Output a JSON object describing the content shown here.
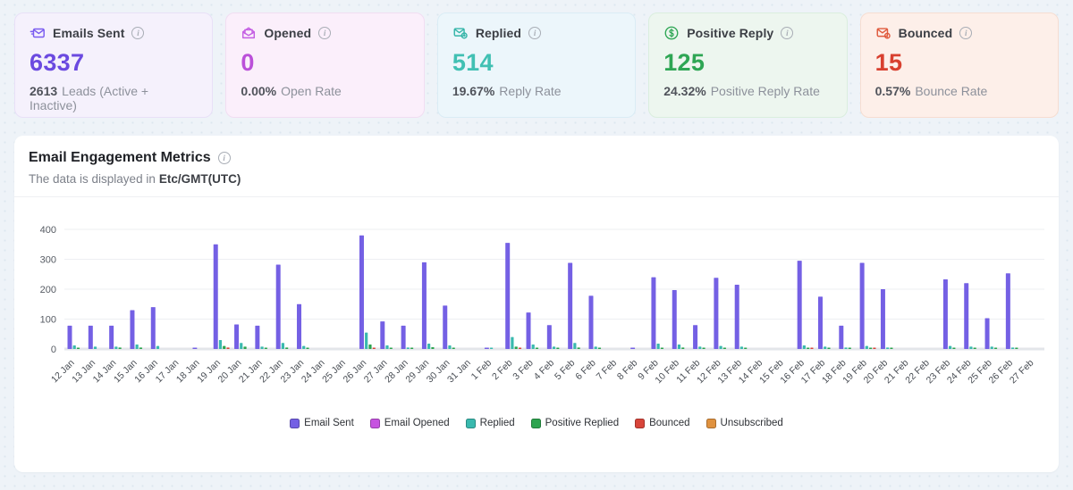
{
  "cards": [
    {
      "label": "Emails Sent",
      "value": "6337",
      "sub_value": "2613",
      "sub_label": "Leads (Active + Inactive)",
      "accent": "#6b4ae0",
      "icon_color": "#7a5cf0",
      "bg": "#f5f1fc",
      "border": "#e8e0f7",
      "icon": "send-envelope-icon"
    },
    {
      "label": "Opened",
      "value": "0",
      "sub_value": "0.00%",
      "sub_label": "Open Rate",
      "accent": "#bb50d9",
      "icon_color": "#c45fe3",
      "bg": "#fbeffb",
      "border": "#f1ddf2",
      "icon": "open-envelope-icon"
    },
    {
      "label": "Replied",
      "value": "514",
      "sub_value": "19.67%",
      "sub_label": "Reply Rate",
      "accent": "#41c0b3",
      "icon_color": "#35b5a9",
      "bg": "#ecf6fb",
      "border": "#daecf5",
      "icon": "reply-envelope-icon"
    },
    {
      "label": "Positive Reply",
      "value": "125",
      "sub_value": "24.32%",
      "sub_label": "Positive Reply Rate",
      "accent": "#2ea654",
      "icon_color": "#2ea654",
      "bg": "#edf6ef",
      "border": "#daeede",
      "icon": "dollar-circle-icon"
    },
    {
      "label": "Bounced",
      "value": "15",
      "sub_value": "0.57%",
      "sub_label": "Bounce Rate",
      "accent": "#d8402f",
      "icon_color": "#e05a3d",
      "bg": "#fdefe9",
      "border": "#f6ddd1",
      "icon": "bounce-envelope-icon"
    }
  ],
  "panel": {
    "title": "Email Engagement Metrics",
    "subtitle_prefix": "The data is displayed in",
    "timezone": "Etc/GMT(UTC)"
  },
  "chart_data": {
    "type": "bar",
    "title": "Email Engagement Metrics",
    "xlabel": "",
    "ylabel": "",
    "ylim": [
      0,
      400
    ],
    "y_ticks": [
      0,
      100,
      200,
      300,
      400
    ],
    "grid": true,
    "legend_position": "bottom",
    "categories": [
      "12 Jan",
      "13 Jan",
      "14 Jan",
      "15 Jan",
      "16 Jan",
      "17 Jan",
      "18 Jan",
      "19 Jan",
      "20 Jan",
      "21 Jan",
      "22 Jan",
      "23 Jan",
      "24 Jan",
      "25 Jan",
      "26 Jan",
      "27 Jan",
      "28 Jan",
      "29 Jan",
      "30 Jan",
      "31 Jan",
      "1 Feb",
      "2 Feb",
      "3 Feb",
      "4 Feb",
      "5 Feb",
      "6 Feb",
      "7 Feb",
      "8 Feb",
      "9 Feb",
      "10 Feb",
      "11 Feb",
      "12 Feb",
      "13 Feb",
      "14 Feb",
      "15 Feb",
      "16 Feb",
      "17 Feb",
      "18 Feb",
      "19 Feb",
      "20 Feb",
      "21 Feb",
      "22 Feb",
      "23 Feb",
      "24 Feb",
      "25 Feb",
      "26 Feb",
      "27 Feb"
    ],
    "series": [
      {
        "name": "Email Sent",
        "color": "#7460e4",
        "values": [
          78,
          78,
          78,
          130,
          140,
          0,
          2,
          350,
          82,
          78,
          282,
          150,
          0,
          0,
          380,
          92,
          78,
          290,
          145,
          0,
          2,
          355,
          122,
          80,
          288,
          178,
          0,
          2,
          240,
          197,
          80,
          238,
          215,
          0,
          0,
          295,
          175,
          78,
          288,
          200,
          0,
          0,
          233,
          220,
          103,
          253,
          0
        ]
      },
      {
        "name": "Email Opened",
        "color": "#c653e0",
        "values": [
          0,
          0,
          0,
          0,
          0,
          0,
          0,
          0,
          0,
          0,
          0,
          0,
          0,
          0,
          0,
          0,
          0,
          0,
          0,
          0,
          0,
          0,
          0,
          0,
          0,
          0,
          0,
          0,
          0,
          0,
          0,
          0,
          0,
          0,
          0,
          0,
          0,
          0,
          0,
          0,
          0,
          0,
          0,
          0,
          0,
          0,
          0
        ]
      },
      {
        "name": "Replied",
        "color": "#39b9ae",
        "values": [
          12,
          8,
          8,
          15,
          10,
          0,
          0,
          30,
          20,
          8,
          20,
          10,
          0,
          0,
          55,
          12,
          5,
          18,
          12,
          0,
          3,
          40,
          15,
          8,
          20,
          8,
          0,
          0,
          18,
          15,
          8,
          10,
          8,
          0,
          0,
          12,
          8,
          5,
          10,
          5,
          0,
          0,
          10,
          8,
          8,
          5,
          0
        ]
      },
      {
        "name": "Positive Replied",
        "color": "#2ca44e",
        "values": [
          3,
          0,
          5,
          5,
          0,
          0,
          0,
          10,
          8,
          3,
          5,
          3,
          0,
          0,
          15,
          3,
          2,
          6,
          4,
          0,
          0,
          8,
          4,
          3,
          5,
          4,
          0,
          0,
          4,
          5,
          3,
          3,
          3,
          0,
          0,
          4,
          3,
          2,
          3,
          2,
          0,
          0,
          4,
          4,
          3,
          3,
          0
        ]
      },
      {
        "name": "Bounced",
        "color": "#d8453a",
        "values": [
          0,
          0,
          0,
          0,
          0,
          0,
          0,
          5,
          0,
          0,
          0,
          0,
          0,
          0,
          2,
          0,
          0,
          0,
          0,
          0,
          0,
          3,
          0,
          0,
          0,
          0,
          0,
          0,
          0,
          0,
          0,
          0,
          0,
          0,
          0,
          2,
          0,
          0,
          3,
          0,
          0,
          0,
          0,
          0,
          0,
          0,
          0
        ]
      },
      {
        "name": "Unsubscribed",
        "color": "#e0923f",
        "values": [
          0,
          0,
          0,
          0,
          0,
          0,
          0,
          0,
          0,
          0,
          0,
          0,
          0,
          0,
          0,
          0,
          0,
          0,
          0,
          0,
          0,
          0,
          0,
          0,
          0,
          0,
          0,
          0,
          0,
          0,
          0,
          0,
          0,
          0,
          0,
          0,
          0,
          0,
          0,
          0,
          0,
          0,
          0,
          0,
          0,
          0,
          0
        ]
      }
    ]
  }
}
